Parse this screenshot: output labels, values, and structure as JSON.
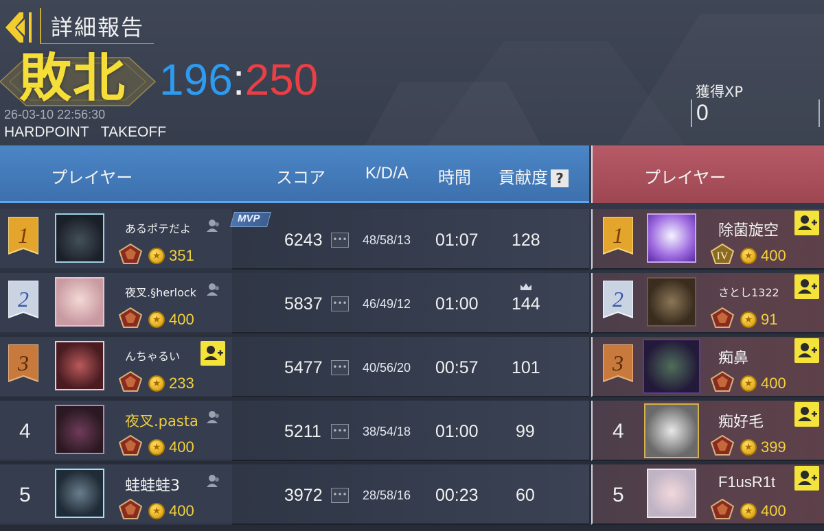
{
  "header": {
    "title": "詳細報告",
    "result": "敗北",
    "score_team": "196",
    "score_separator": ":",
    "score_enemy": "250",
    "datetime": "26-03-10 22:56:30",
    "mode": "HARDPOINT TAKEOFF",
    "xp_label": "獲得XP",
    "xp_value": "0"
  },
  "columns": {
    "player": "プレイヤー",
    "score": "スコア",
    "kda": "K/D/A",
    "time": "時間",
    "contribution": "貢献度",
    "help": "?",
    "enemy_player": "プレイヤー"
  },
  "mvp_label": "MVP",
  "team": [
    {
      "rank": "1",
      "name": "あるポテだよ",
      "level": "351",
      "score": "6243",
      "kda": "48/58/13",
      "time": "01:07",
      "contribution": "128"
    },
    {
      "rank": "2",
      "name": "夜叉.§herlock",
      "level": "400",
      "score": "5837",
      "kda": "46/49/12",
      "time": "01:00",
      "contribution": "144"
    },
    {
      "rank": "3",
      "name": "んちゃるい",
      "level": "233",
      "score": "5477",
      "kda": "40/56/20",
      "time": "00:57",
      "contribution": "101"
    },
    {
      "rank": "4",
      "name": "夜叉.pasta",
      "level": "400",
      "score": "5211",
      "kda": "38/54/18",
      "time": "01:00",
      "contribution": "99"
    },
    {
      "rank": "5",
      "name": "蛙蛙蛙3",
      "level": "400",
      "score": "3972",
      "kda": "28/58/16",
      "time": "00:23",
      "contribution": "60"
    }
  ],
  "enemy": [
    {
      "rank": "1",
      "name": "除菌旋空",
      "level": "400",
      "tier": "IV"
    },
    {
      "rank": "2",
      "name": "さとし1322",
      "level": "91"
    },
    {
      "rank": "3",
      "name": "痴鼻",
      "level": "400"
    },
    {
      "rank": "4",
      "name": "痴好毛",
      "level": "399"
    },
    {
      "rank": "5",
      "name": "F1usR1t",
      "level": "400"
    }
  ],
  "colors": {
    "team_blue": "#2e9bf2",
    "enemy_red": "#ea3f44",
    "defeat_yellow": "#f6de38",
    "add_friend_yellow": "#f4e33a"
  },
  "icons": [
    "back-arrow-icon",
    "friend-icon",
    "add-friend-icon",
    "more-icon",
    "crown-icon",
    "coin-icon",
    "rank-emblem-icon"
  ]
}
